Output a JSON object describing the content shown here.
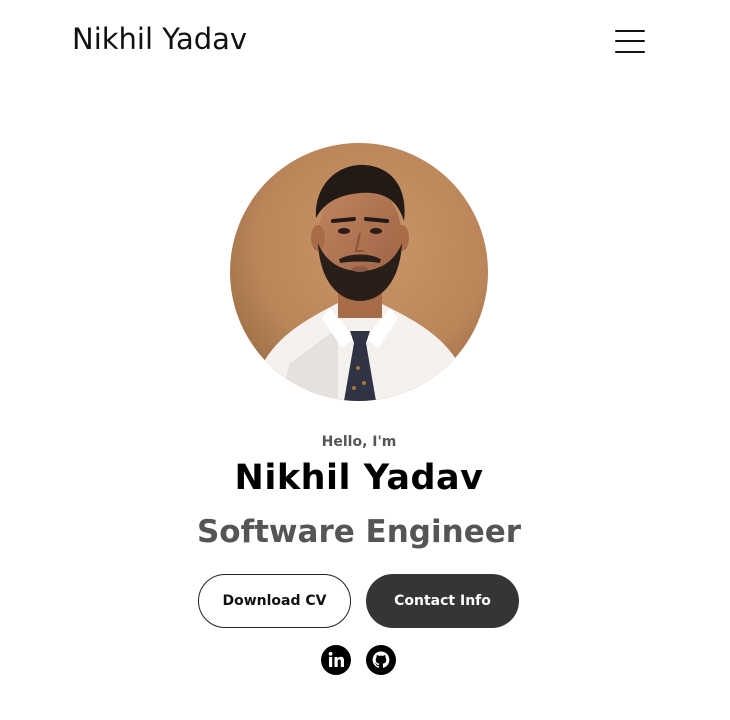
{
  "header": {
    "logo_text": "Nikhil Yadav",
    "menu_icon": "hamburger-menu-icon"
  },
  "profile": {
    "photo_icon": "profile-photo",
    "greeting": "Hello, I'm",
    "name": "Nikhil Yadav",
    "title": "Software Engineer"
  },
  "actions": {
    "download_cv_label": "Download CV",
    "contact_info_label": "Contact Info"
  },
  "social": {
    "linkedin_icon": "linkedin-icon",
    "github_icon": "github-icon"
  },
  "colors": {
    "text_primary": "#000000",
    "text_secondary": "#555555",
    "button_dark": "#353535"
  }
}
